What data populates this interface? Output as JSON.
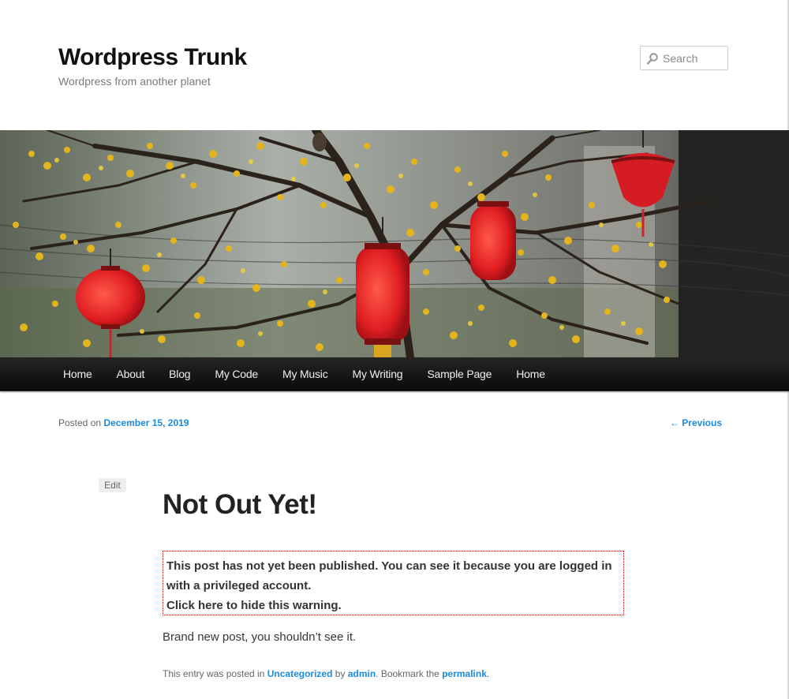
{
  "header": {
    "site_title": "Wordpress Trunk",
    "site_description": "Wordpress from another planet"
  },
  "search": {
    "placeholder": "Search",
    "icon": "search-icon"
  },
  "banner": {
    "icon": "header-image"
  },
  "nav": {
    "items": [
      "Home",
      "About",
      "Blog",
      "My Code",
      "My Music",
      "My Writing",
      "Sample Page",
      "Home"
    ]
  },
  "post_meta": {
    "posted_on_label": "Posted on",
    "date": "December 15, 2019",
    "previous_link": "← Previous"
  },
  "post": {
    "edit_label": "Edit",
    "title": "Not Out Yet!",
    "warning_text": "This post has not yet been published. You can see it because you are logged in with a privileged account.",
    "warning_hide": "Click here to hide this warning.",
    "body": "Brand new post, you shouldn’t see it."
  },
  "entry_footer": {
    "prefix": "This entry was posted in",
    "category": "Uncategorized",
    "by_label": "by",
    "author": "admin",
    "bookmark_label": ". Bookmark the",
    "permalink": "permalink",
    "suffix": "."
  },
  "colors": {
    "link": "#1b8be0",
    "nav_background": "#111111",
    "warning_border": "#cc0000",
    "lantern_red": "#e8262a",
    "blossom_yellow": "#e6b820"
  }
}
